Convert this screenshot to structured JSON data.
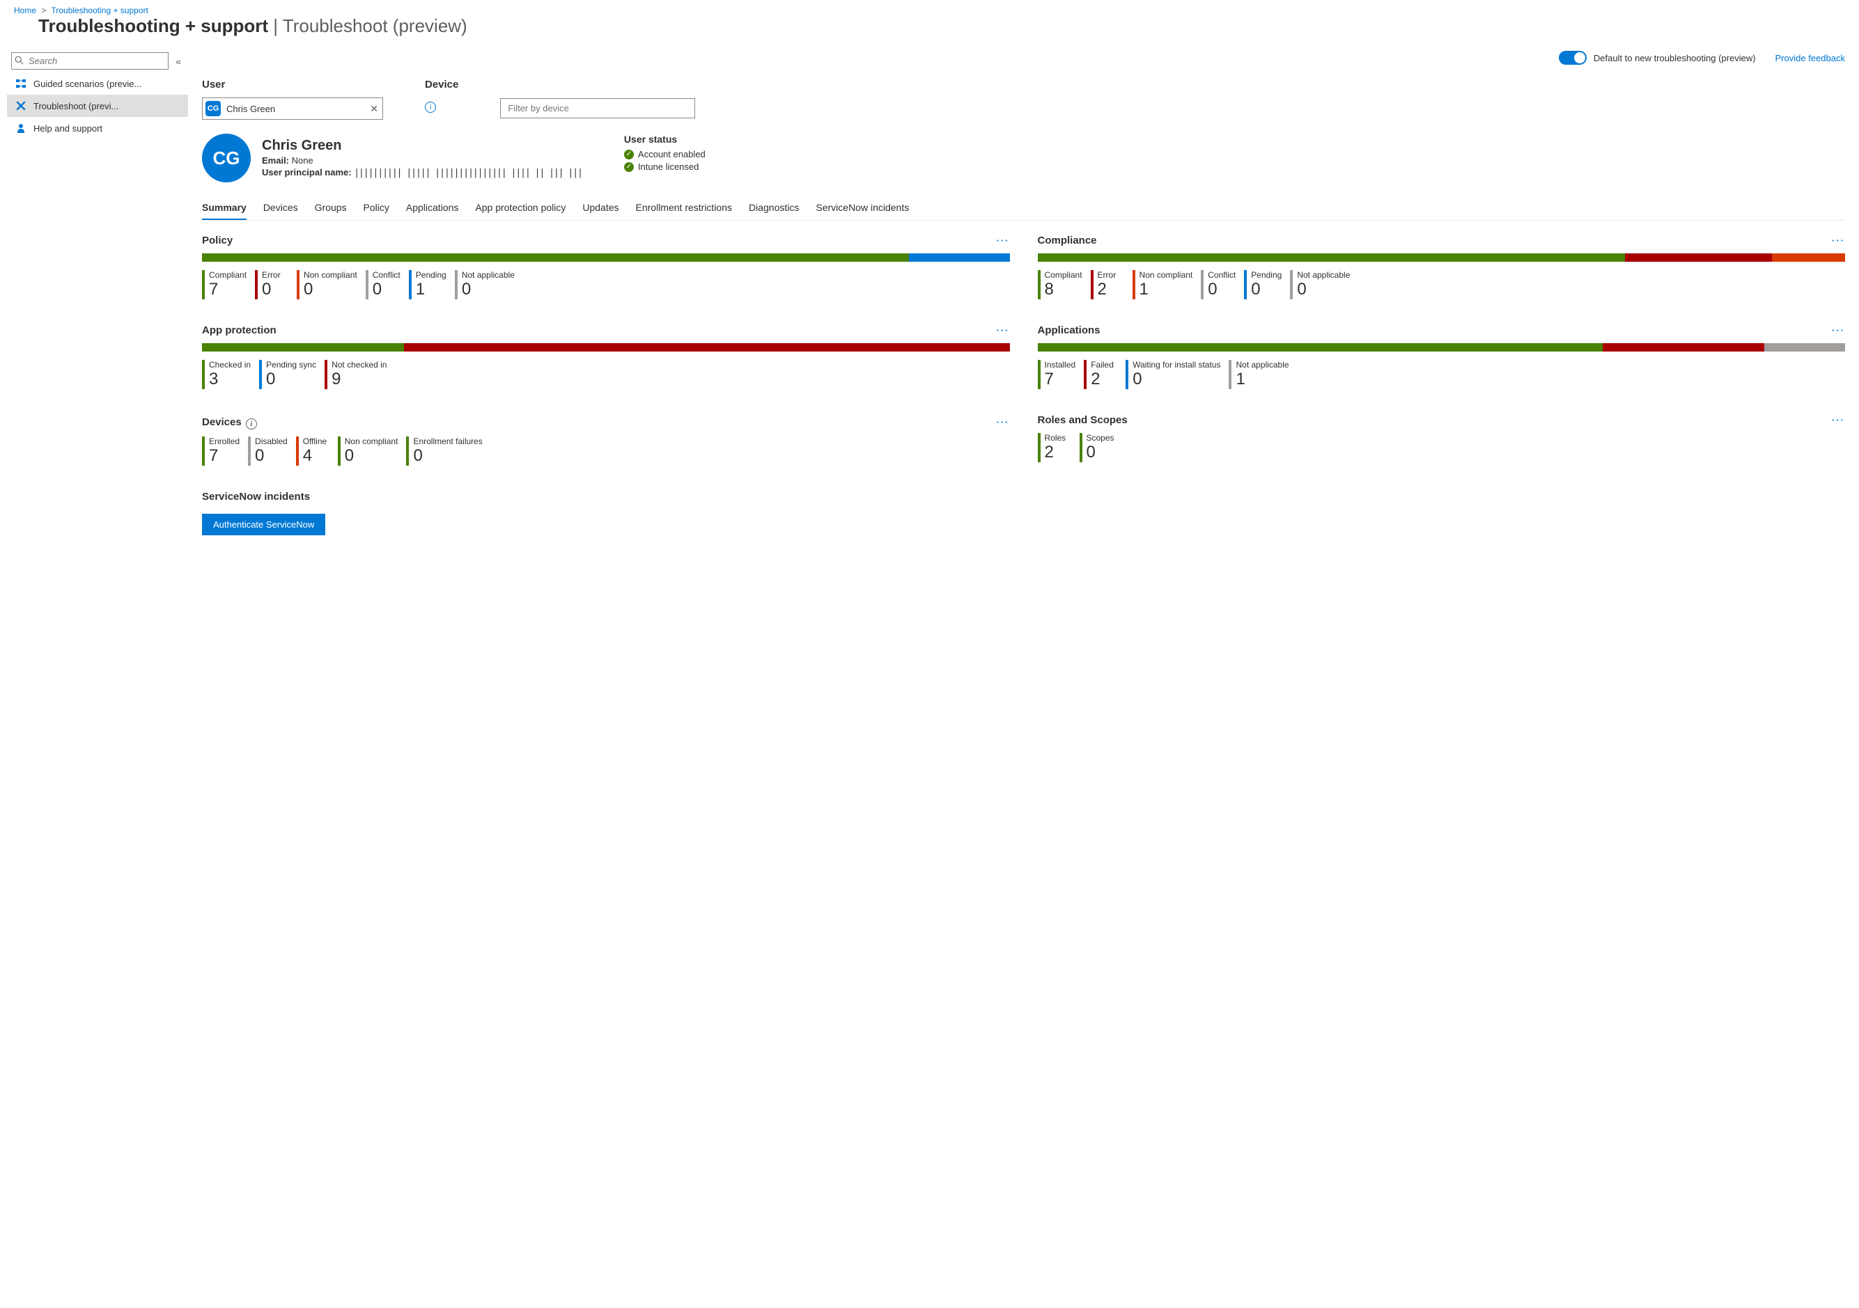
{
  "breadcrumb": {
    "home": "Home",
    "section": "Troubleshooting + support"
  },
  "pageTitle": {
    "main": "Troubleshooting + support",
    "sep": " | ",
    "sub": "Troubleshoot (preview)"
  },
  "search": {
    "placeholder": "Search"
  },
  "nav": {
    "guided": "Guided scenarios (previe...",
    "troubleshoot": "Troubleshoot (previ...",
    "help": "Help and support"
  },
  "toolbar": {
    "toggleLabel": "Default to new troubleshooting (preview)",
    "feedback": "Provide feedback"
  },
  "filters": {
    "userLabel": "User",
    "deviceLabel": "Device",
    "devicePlaceholder": "Filter by device",
    "chip": {
      "initials": "CG",
      "name": "Chris Green"
    }
  },
  "user": {
    "initials": "CG",
    "name": "Chris Green",
    "emailLabel": "Email:",
    "emailValue": "None",
    "upnLabel": "User principal name:",
    "upnValue": "|||||||||| ||||| ||||||||||||||| |||| || ||| |||",
    "statusTitle": "User status",
    "status1": "Account enabled",
    "status2": "Intune licensed"
  },
  "tabs": [
    "Summary",
    "Devices",
    "Groups",
    "Policy",
    "Applications",
    "App protection policy",
    "Updates",
    "Enrollment restrictions",
    "Diagnostics",
    "ServiceNow incidents"
  ],
  "cards": {
    "policy": {
      "title": "Policy",
      "stats": [
        {
          "label": "Compliant",
          "value": "7",
          "cls": "sg"
        },
        {
          "label": "Error",
          "value": "0",
          "cls": "sr"
        },
        {
          "label": "Non compliant",
          "value": "0",
          "cls": "so"
        },
        {
          "label": "Conflict",
          "value": "0",
          "cls": "sgr"
        },
        {
          "label": "Pending",
          "value": "1",
          "cls": "sbl"
        },
        {
          "label": "Not applicable",
          "value": "0",
          "cls": "sgr"
        }
      ]
    },
    "compliance": {
      "title": "Compliance",
      "stats": [
        {
          "label": "Compliant",
          "value": "8",
          "cls": "sg"
        },
        {
          "label": "Error",
          "value": "2",
          "cls": "sr"
        },
        {
          "label": "Non compliant",
          "value": "1",
          "cls": "so"
        },
        {
          "label": "Conflict",
          "value": "0",
          "cls": "sgr"
        },
        {
          "label": "Pending",
          "value": "0",
          "cls": "sbl"
        },
        {
          "label": "Not applicable",
          "value": "0",
          "cls": "sgr"
        }
      ]
    },
    "appprotection": {
      "title": "App protection",
      "stats": [
        {
          "label": "Checked in",
          "value": "3",
          "cls": "sg"
        },
        {
          "label": "Pending sync",
          "value": "0",
          "cls": "sbl"
        },
        {
          "label": "Not checked in",
          "value": "9",
          "cls": "sr"
        }
      ]
    },
    "applications": {
      "title": "Applications",
      "stats": [
        {
          "label": "Installed",
          "value": "7",
          "cls": "sg"
        },
        {
          "label": "Failed",
          "value": "2",
          "cls": "sr"
        },
        {
          "label": "Waiting for install status",
          "value": "0",
          "cls": "sbl"
        },
        {
          "label": "Not applicable",
          "value": "1",
          "cls": "sgr"
        }
      ]
    },
    "devices": {
      "title": "Devices",
      "stats": [
        {
          "label": "Enrolled",
          "value": "7",
          "cls": "sg"
        },
        {
          "label": "Disabled",
          "value": "0",
          "cls": "sgr"
        },
        {
          "label": "Offline",
          "value": "4",
          "cls": "so"
        },
        {
          "label": "Non compliant",
          "value": "0",
          "cls": "sg"
        },
        {
          "label": "Enrollment failures",
          "value": "0",
          "cls": "sg"
        }
      ]
    },
    "roles": {
      "title": "Roles and Scopes",
      "stats": [
        {
          "label": "Roles",
          "value": "2",
          "cls": "sg"
        },
        {
          "label": "Scopes",
          "value": "0",
          "cls": "sg"
        }
      ]
    }
  },
  "servicenow": {
    "title": "ServiceNow incidents",
    "button": "Authenticate ServiceNow"
  },
  "chart_data": [
    {
      "type": "bar",
      "title": "Policy",
      "categories": [
        "Compliant",
        "Error",
        "Non compliant",
        "Conflict",
        "Pending",
        "Not applicable"
      ],
      "values": [
        7,
        0,
        0,
        0,
        1,
        0
      ]
    },
    {
      "type": "bar",
      "title": "Compliance",
      "categories": [
        "Compliant",
        "Error",
        "Non compliant",
        "Conflict",
        "Pending",
        "Not applicable"
      ],
      "values": [
        8,
        2,
        1,
        0,
        0,
        0
      ]
    },
    {
      "type": "bar",
      "title": "App protection",
      "categories": [
        "Checked in",
        "Pending sync",
        "Not checked in"
      ],
      "values": [
        3,
        0,
        9
      ]
    },
    {
      "type": "bar",
      "title": "Applications",
      "categories": [
        "Installed",
        "Failed",
        "Waiting for install status",
        "Not applicable"
      ],
      "values": [
        7,
        2,
        0,
        1
      ]
    },
    {
      "type": "bar",
      "title": "Devices",
      "categories": [
        "Enrolled",
        "Disabled",
        "Offline",
        "Non compliant",
        "Enrollment failures"
      ],
      "values": [
        7,
        0,
        4,
        0,
        0
      ]
    },
    {
      "type": "bar",
      "title": "Roles and Scopes",
      "categories": [
        "Roles",
        "Scopes"
      ],
      "values": [
        2,
        0
      ]
    }
  ]
}
